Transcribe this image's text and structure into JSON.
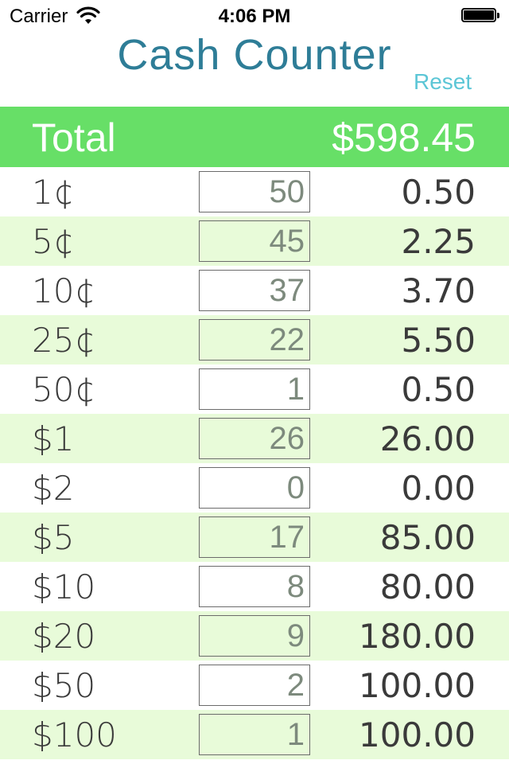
{
  "status_bar": {
    "carrier": "Carrier",
    "time": "4:06 PM"
  },
  "header": {
    "title": "Cash Counter",
    "reset_label": "Reset"
  },
  "total": {
    "label": "Total",
    "value": "$598.45"
  },
  "rows": [
    {
      "denomination": "1¢",
      "quantity": "50",
      "amount": "0.50"
    },
    {
      "denomination": "5¢",
      "quantity": "45",
      "amount": "2.25"
    },
    {
      "denomination": "10¢",
      "quantity": "37",
      "amount": "3.70"
    },
    {
      "denomination": "25¢",
      "quantity": "22",
      "amount": "5.50"
    },
    {
      "denomination": "50¢",
      "quantity": "1",
      "amount": "0.50"
    },
    {
      "denomination": "$1",
      "quantity": "26",
      "amount": "26.00"
    },
    {
      "denomination": "$2",
      "quantity": "0",
      "amount": "0.00"
    },
    {
      "denomination": "$5",
      "quantity": "17",
      "amount": "85.00"
    },
    {
      "denomination": "$10",
      "quantity": "8",
      "amount": "80.00"
    },
    {
      "denomination": "$20",
      "quantity": "9",
      "amount": "180.00"
    },
    {
      "denomination": "$50",
      "quantity": "2",
      "amount": "100.00"
    },
    {
      "denomination": "$100",
      "quantity": "1",
      "amount": "100.00"
    }
  ],
  "colors": {
    "total_bar": "#67df67",
    "alt_row": "#e8fbd9",
    "title": "#2e7d97",
    "reset": "#5cc6d6"
  },
  "icons": [
    "wifi-icon",
    "battery-icon"
  ]
}
